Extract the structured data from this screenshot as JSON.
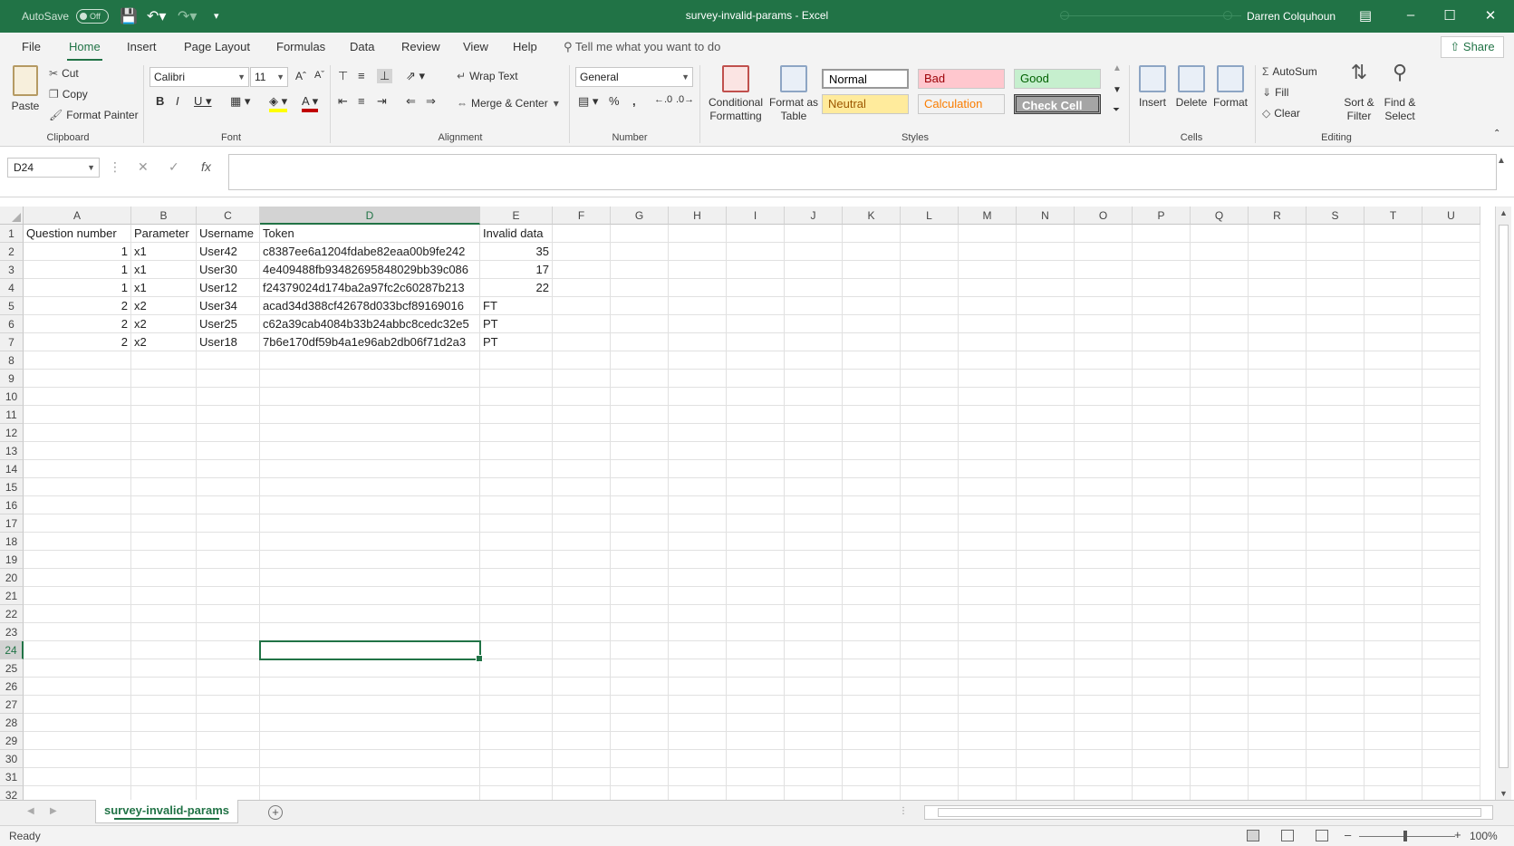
{
  "titlebar": {
    "autosave_label": "AutoSave",
    "autosave_state": "Off",
    "document_title": "survey-invalid-params  -  Excel",
    "user_name": "Darren Colquhoun"
  },
  "tabs": [
    "File",
    "Home",
    "Insert",
    "Page Layout",
    "Formulas",
    "Data",
    "Review",
    "View",
    "Help"
  ],
  "active_tab": "Home",
  "tell_me": "Tell me what you want to do",
  "share_label": "Share",
  "ribbon": {
    "clipboard": {
      "group": "Clipboard",
      "paste": "Paste",
      "cut": "Cut",
      "copy": "Copy",
      "format_painter": "Format Painter"
    },
    "font": {
      "group": "Font",
      "font_name": "Calibri",
      "font_size": "11"
    },
    "alignment": {
      "group": "Alignment",
      "wrap_text": "Wrap Text",
      "merge_center": "Merge & Center"
    },
    "number": {
      "group": "Number",
      "format": "General"
    },
    "styles": {
      "group": "Styles",
      "conditional_formatting": "Conditional Formatting",
      "format_as_table": "Format as Table",
      "cells": [
        {
          "label": "Normal",
          "bg": "#ffffff",
          "fg": "#000000"
        },
        {
          "label": "Bad",
          "bg": "#ffc7ce",
          "fg": "#9c0006"
        },
        {
          "label": "Good",
          "bg": "#c6efce",
          "fg": "#006100"
        },
        {
          "label": "Neutral",
          "bg": "#ffeb9c",
          "fg": "#9c5700"
        },
        {
          "label": "Calculation",
          "bg": "#f2f2f2",
          "fg": "#fa7d00"
        },
        {
          "label": "Check Cell",
          "bg": "#a5a5a5",
          "fg": "#ffffff"
        }
      ]
    },
    "cells": {
      "group": "Cells",
      "insert": "Insert",
      "delete": "Delete",
      "format": "Format"
    },
    "editing": {
      "group": "Editing",
      "autosum": "AutoSum",
      "fill": "Fill",
      "clear": "Clear",
      "sort_filter": "Sort & Filter",
      "find_select": "Find & Select"
    }
  },
  "formula_bar": {
    "name_box": "D24",
    "formula": ""
  },
  "columns": [
    "A",
    "B",
    "C",
    "D",
    "E",
    "F",
    "G",
    "H",
    "I",
    "J",
    "K",
    "L",
    "M",
    "N",
    "O",
    "P",
    "Q",
    "R",
    "S",
    "T",
    "U"
  ],
  "selected_column": "D",
  "selected_row": 24,
  "visible_rows": 32,
  "table": {
    "rows": [
      [
        "Question number",
        "Parameter",
        "Username",
        "Token",
        "Invalid data"
      ],
      [
        "1",
        "x1",
        "User42",
        "c8387ee6a1204fdabe82eaa00b9fe242",
        "35"
      ],
      [
        "1",
        "x1",
        "User30",
        "4e409488fb93482695848029bb39c086",
        "17"
      ],
      [
        "1",
        "x1",
        "User12",
        "f24379024d174ba2a97fc2c60287b213",
        "22"
      ],
      [
        "2",
        "x2",
        "User34",
        "acad34d388cf42678d033bcf89169016",
        "FT"
      ],
      [
        "2",
        "x2",
        "User25",
        "c62a39cab4084b33b24abbc8cedc32e5",
        "PT"
      ],
      [
        "2",
        "x2",
        "User18",
        "7b6e170df59b4a1e96ab2db06f71d2a3",
        "PT"
      ]
    ]
  },
  "sheet_tab": "survey-invalid-params",
  "status": {
    "ready": "Ready",
    "zoom": "100%"
  },
  "accent_color": "#217346"
}
